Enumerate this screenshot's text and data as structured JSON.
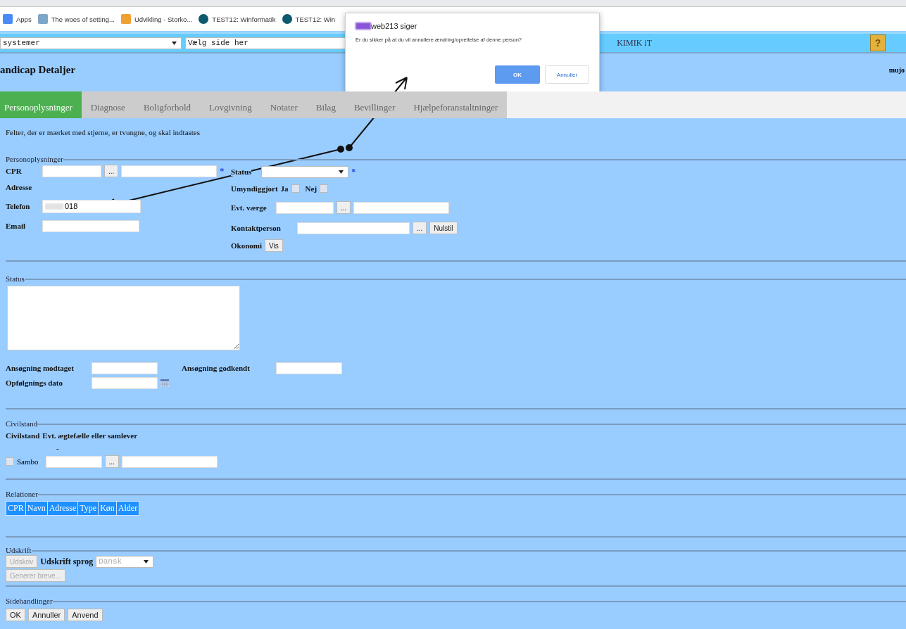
{
  "bookmarks": [
    "Apps",
    "The woes of setting...",
    "Udvikling - Storko...",
    "TEST12: Winformatik",
    "TEST12: Win"
  ],
  "topbar": {
    "system_select": "systemer",
    "page_select": "Vælg side her",
    "brand": "KIMIK iT",
    "help": "?"
  },
  "header": {
    "title": "andicap Detaljer",
    "user": "mujo"
  },
  "tabs": [
    {
      "label": "Personoplysninger",
      "selected": true
    },
    {
      "label": "Diagnose",
      "selected": false
    },
    {
      "label": "Boligforhold",
      "selected": false
    },
    {
      "label": "Lovgivning",
      "selected": false
    },
    {
      "label": "Notater",
      "selected": false
    },
    {
      "label": "Bilag",
      "selected": false
    },
    {
      "label": "Bevillinger",
      "selected": false
    },
    {
      "label": "Hjælpeforanstaltninger",
      "selected": false
    }
  ],
  "note": "Felter, der er mærket med stjerne, er tvungne, og skal indtastes",
  "person": {
    "legend": "Personoplysninger",
    "cpr": "CPR",
    "adresse": "Adresse",
    "telefon": "Telefon",
    "telefon_value": "018",
    "email": "Email",
    "required": "*",
    "status": "Status",
    "umyndiggjort": "Umyndiggjort",
    "ja": "Ja",
    "ja_checked": false,
    "nej": "Nej",
    "nej_checked": false,
    "vaerge": "Evt. værge",
    "kontakt": "Kontaktperson",
    "nulstil": "Nulstil",
    "okonomi": "Okonomi",
    "vis": "Vis",
    "lookup": "..."
  },
  "status": {
    "legend": "Status",
    "modtaget": "Ansøgning modtaget",
    "godkendt": "Ansøgning godkendt",
    "opfolgning": "Opfølgnings dato"
  },
  "civil": {
    "legend": "Civilstand",
    "col_1": "Civilstand",
    "col_2": "Evt. ægtefælle eller samlever",
    "dash": "-",
    "sambo": "Sambo",
    "sambo_checked": false,
    "lookup": "..."
  },
  "relationer": {
    "legend": "Relationer",
    "columns": [
      "CPR",
      "Navn",
      "Adresse",
      "Type",
      "Køn",
      "Alder"
    ]
  },
  "udskrift": {
    "legend": "Udskrift",
    "print": "Udskriv",
    "print_disabled": true,
    "lang_label": "Udskrift sprog",
    "lang": "Dansk",
    "letters": "Generer breve...",
    "letters_disabled": true
  },
  "side": {
    "legend": "Sidehandlinger",
    "buttons": [
      "OK",
      "Annuller",
      "Anvend"
    ]
  },
  "dialog": {
    "title": "web213 siger",
    "message": "Er du sikker på at du vil annullere ændring/oprettelse af denne person?",
    "ok": "OK",
    "cancel": "Annuller"
  }
}
